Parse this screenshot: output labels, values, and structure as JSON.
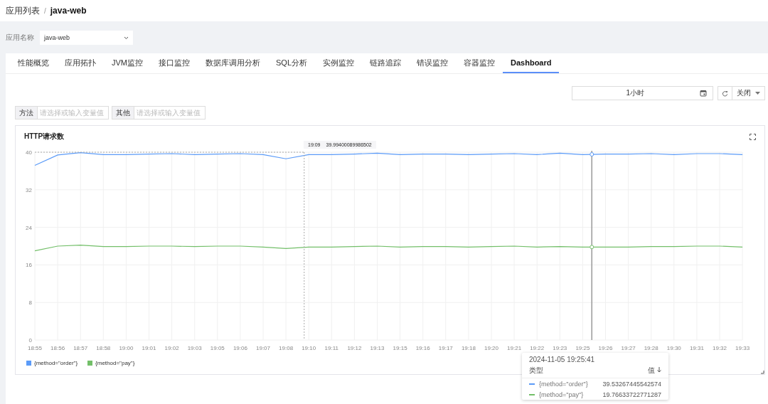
{
  "breadcrumb_separator": "/",
  "breadcrumb": [
    {
      "label": "应用列表",
      "current": false
    },
    {
      "label": "java-web",
      "current": true
    }
  ],
  "app_filter": {
    "label": "应用名称",
    "value": "java-web"
  },
  "tabs": [
    {
      "label": "性能概览",
      "selected": false
    },
    {
      "label": "应用拓扑",
      "selected": false
    },
    {
      "label": "JVM监控",
      "selected": false
    },
    {
      "label": "接口监控",
      "selected": false
    },
    {
      "label": "数据库调用分析",
      "selected": false
    },
    {
      "label": "SQL分析",
      "selected": false
    },
    {
      "label": "实例监控",
      "selected": false
    },
    {
      "label": "链路追踪",
      "selected": false
    },
    {
      "label": "错误监控",
      "selected": false
    },
    {
      "label": "容器监控",
      "selected": false
    },
    {
      "label": "Dashboard",
      "selected": true
    }
  ],
  "time_range": {
    "value": "1小时"
  },
  "refresh": {
    "value": "关闭"
  },
  "variables": [
    {
      "label": "方法",
      "placeholder": "请选择或输入变量值"
    },
    {
      "label": "其他",
      "placeholder": "请选择或输入变量值"
    }
  ],
  "panel": {
    "title": "HTTP请求数",
    "hover_label": {
      "time": "19:09",
      "value": "39.99400089986502"
    },
    "tooltip": {
      "time": "2024-11-05 19:25:41",
      "column_type": "类型",
      "column_value": "值",
      "rows": [
        {
          "name": "{method=\"order\"}",
          "value": "39.53267445542574",
          "color": "#5b9bf8"
        },
        {
          "name": "{method=\"pay\"}",
          "value": "19.76633722771287",
          "color": "#73bf69"
        }
      ]
    },
    "chart_data": {
      "type": "line",
      "grid": true,
      "categories": [
        "18:55",
        "18:56",
        "18:57",
        "18:58",
        "19:00",
        "19:01",
        "19:02",
        "19:03",
        "19:05",
        "19:06",
        "19:07",
        "19:08",
        "19:10",
        "19:11",
        "19:12",
        "19:13",
        "19:15",
        "19:16",
        "19:17",
        "19:18",
        "19:20",
        "19:21",
        "19:22",
        "19:23",
        "19:25",
        "19:26",
        "19:27",
        "19:28",
        "19:30",
        "19:31",
        "19:32",
        "19:33"
      ],
      "ylim": [
        0,
        40
      ],
      "yticks": [
        0,
        8,
        16,
        24,
        32,
        40
      ],
      "series": [
        {
          "name": "{method=\"order\"}",
          "color": "#5b9bf8",
          "values": [
            37.2,
            39.4,
            39.9,
            39.5,
            39.5,
            39.6,
            39.7,
            39.5,
            39.6,
            39.7,
            39.5,
            38.6,
            39.5,
            39.5,
            39.6,
            39.8,
            39.5,
            39.6,
            39.6,
            39.5,
            39.6,
            39.7,
            39.5,
            39.8,
            39.5,
            39.6,
            39.6,
            39.7,
            39.5,
            39.7,
            39.7,
            39.5
          ]
        },
        {
          "name": "{method=\"pay\"}",
          "color": "#73bf69",
          "values": [
            19.0,
            20.0,
            20.2,
            19.9,
            19.9,
            20.0,
            20.0,
            19.9,
            20.0,
            20.0,
            19.8,
            19.5,
            19.8,
            19.8,
            19.9,
            20.0,
            19.8,
            19.9,
            19.9,
            19.8,
            19.9,
            20.0,
            19.8,
            19.9,
            19.8,
            19.8,
            19.8,
            19.9,
            19.9,
            20.0,
            20.0,
            19.8
          ]
        }
      ]
    }
  }
}
